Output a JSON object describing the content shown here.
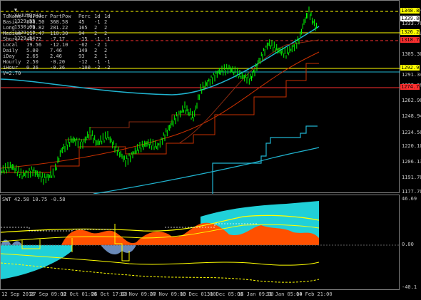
{
  "header": {
    "symbol_timeframe": "XAUUSD,H4",
    "open": "1329.55",
    "high": "1330.09",
    "low": "1329.41",
    "close": "1329.54"
  },
  "stats_table": {
    "headers": [
      "TdName",
      "TdPower",
      "PartPow",
      "Perc",
      "1d",
      "1d"
    ],
    "rows": [
      [
        "Basic",
        "808.50",
        "368.58",
        "45",
        "-1",
        "2"
      ],
      [
        "Long",
        "170.82",
        "281.22",
        "165",
        "2",
        "2"
      ],
      [
        "Medium",
        "117.47",
        "110.30",
        "94",
        "2",
        "2"
      ],
      [
        "Short",
        "46.72",
        "-7.17",
        "-15",
        "-1",
        "-1"
      ],
      [
        "Local",
        "19.56",
        "-12.10",
        "-62",
        "-2",
        "1"
      ],
      [
        "Daily",
        "5.00",
        "7.46",
        "149",
        "2",
        "2"
      ],
      [
        "iDay",
        "2.65",
        "2.46",
        "93",
        "2",
        "1"
      ],
      [
        "Hourly",
        "2.50",
        "-0.20",
        "-12",
        "-1",
        "-1"
      ],
      [
        "iHour",
        "0.36",
        "-0.36",
        "-100",
        "-2",
        "-2"
      ]
    ],
    "footer": "V=2.70"
  },
  "price_axis": {
    "labels": [
      "1348.84",
      "1333.70",
      "1319.26",
      "1305.30",
      "1291.34",
      "1277.38",
      "1262.90",
      "1248.94",
      "1234.50",
      "1220.10",
      "1206.13",
      "1191.70",
      "1177.70"
    ],
    "tags": [
      {
        "text": "1348.84",
        "color": "#ffff00"
      },
      {
        "text": "1339.86",
        "color": "#ffffff"
      },
      {
        "text": "1326.21",
        "color": "#ffff00"
      },
      {
        "text": "1318.74",
        "color": "#ff3030"
      },
      {
        "text": "1292.95",
        "color": "#ffff00"
      },
      {
        "text": "1274.70",
        "color": "#ff3030"
      }
    ]
  },
  "indicator": {
    "label": "SWT 42.58 10.75 -0.58",
    "axis": [
      "46.69",
      "0.00",
      "-40.1"
    ]
  },
  "time_axis": [
    "12 Sep 2018",
    "27 Sep 09:00",
    "12 Oct 01:00",
    "26 Oct 17:00",
    "12 Nov 09:00",
    "27 Nov 09:00",
    "13 Dec 01:00",
    "31 Dec 05:00",
    "16 Jan 09:00",
    "31 Jan 05:00",
    "14 Feb 21:00"
  ],
  "colors": {
    "candles": "#00ff00",
    "cyan_line": "#20b4d0",
    "red_line": "#c83000",
    "yellow": "#ffff00",
    "fill_cyan": "#20d0d8",
    "fill_orange": "#ff5000"
  }
}
